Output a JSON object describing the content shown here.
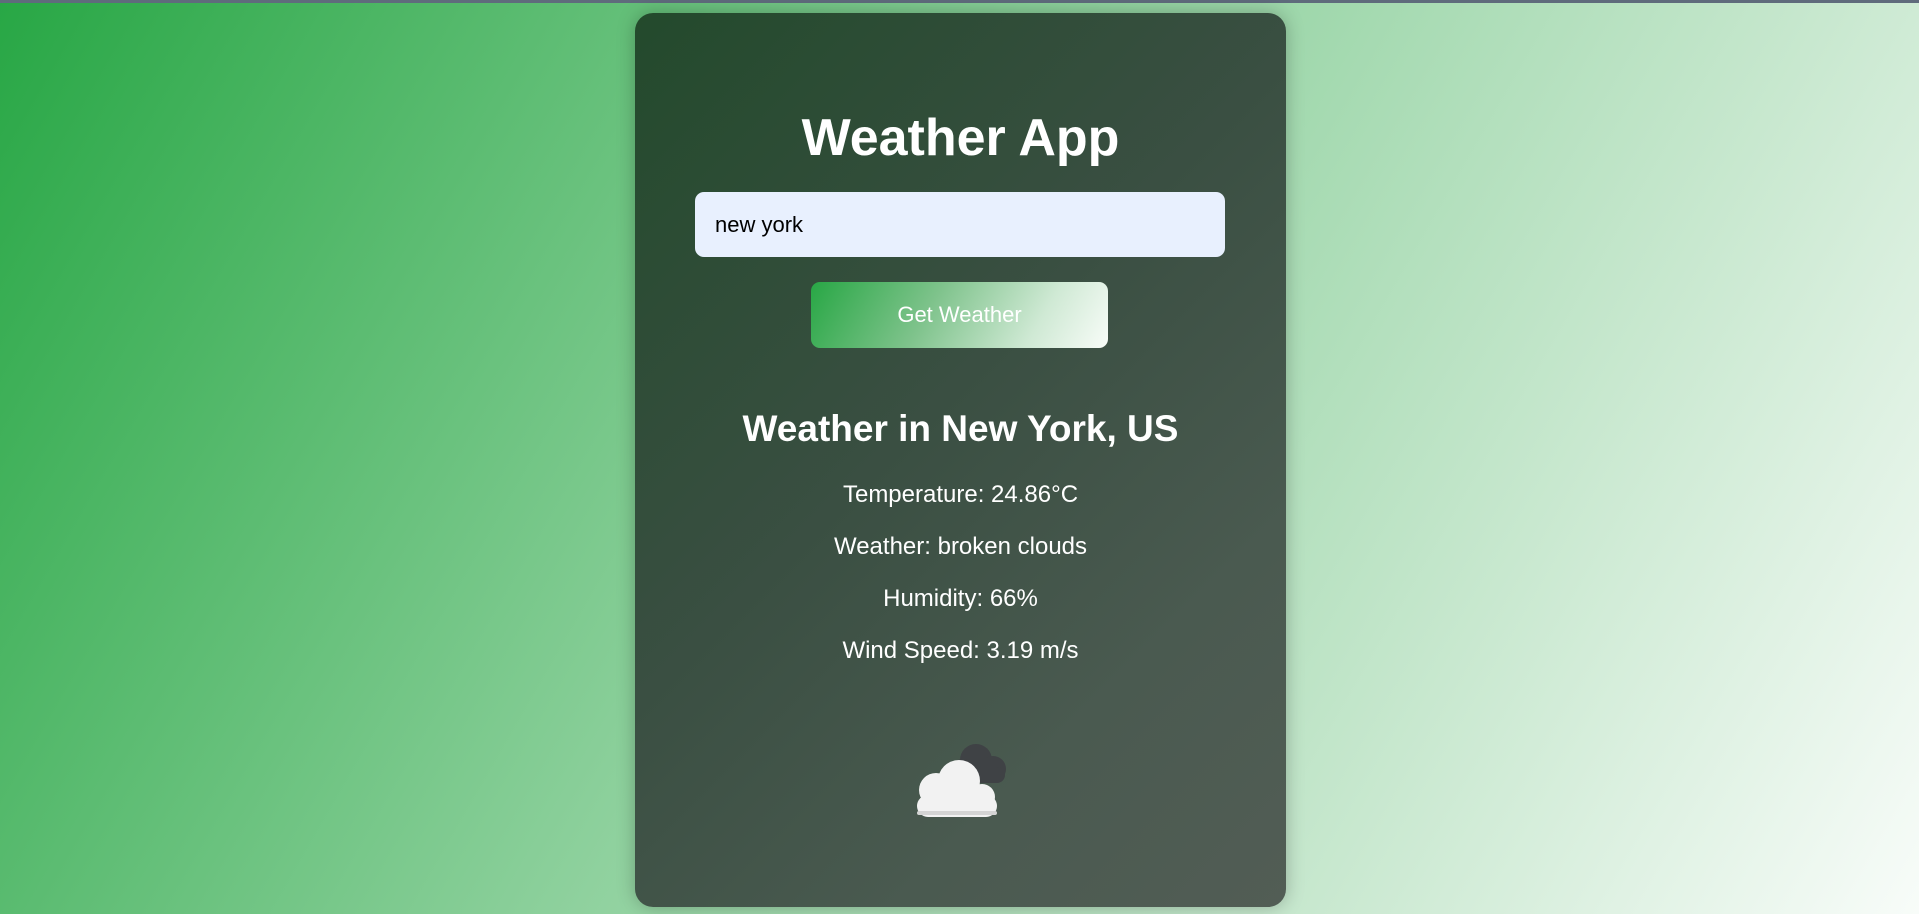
{
  "app": {
    "title": "Weather App"
  },
  "search": {
    "value": "new york",
    "button_label": "Get Weather"
  },
  "result": {
    "heading": "Weather in New York, US",
    "temperature": "Temperature: 24.86°C",
    "condition": "Weather: broken clouds",
    "humidity": "Humidity: 66%",
    "wind_speed": "Wind Speed: 3.19 m/s",
    "icon": "broken-clouds-icon"
  },
  "colors": {
    "background_gradient_start": "#28a745",
    "background_gradient_end": "#f8fcf9",
    "card_gradient_start": "#234a2c",
    "card_gradient_end": "#525d55",
    "input_background": "#e8f0fe",
    "text": "#ffffff"
  }
}
